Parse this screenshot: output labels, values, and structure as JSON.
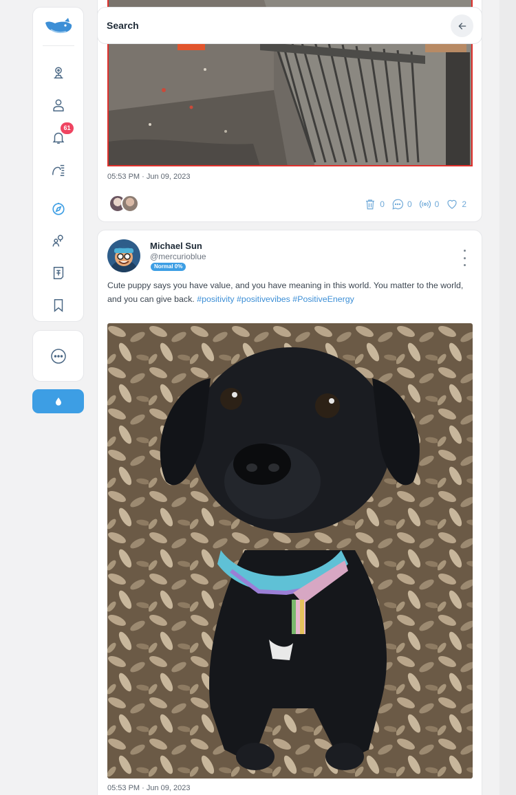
{
  "header": {
    "title": "Search"
  },
  "sidebar": {
    "items": [
      {
        "icon": "pin-icon"
      },
      {
        "icon": "user-icon"
      },
      {
        "icon": "bell-icon",
        "badge": "61"
      },
      {
        "icon": "feed-icon"
      },
      {
        "icon": "compass-icon",
        "active": true
      },
      {
        "icon": "people-icon"
      },
      {
        "icon": "document-icon"
      },
      {
        "icon": "bookmark-icon"
      }
    ]
  },
  "post1": {
    "timestamp": "05:53 PM · Jun 09, 2023",
    "stats": {
      "deletes": "0",
      "comments": "0",
      "broadcasts": "0",
      "likes": "2"
    }
  },
  "post2": {
    "author_name": "Michael Sun",
    "author_handle": "@mercurioblue",
    "rank_badge": "Normal 0%",
    "text": "Cute puppy says you have value, and you have meaning in this world. You matter to the world, and you can give back. ",
    "hashtags": "#positivity #positivevibes #PositiveEnergy",
    "timestamp": "05:53 PM · Jun 09, 2023"
  },
  "colors": {
    "accent": "#3d9ee4",
    "badge": "#ef4461",
    "link": "#3d8fd6",
    "highlight_border": "#e0302c"
  }
}
